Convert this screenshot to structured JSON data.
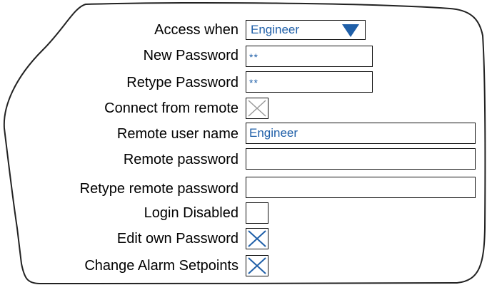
{
  "form": {
    "access_when": {
      "label": "Access when",
      "value": "Engineer"
    },
    "new_password": {
      "label": "New Password",
      "value": "**"
    },
    "retype_password": {
      "label": "Retype Password",
      "value": "**"
    },
    "connect_from_remote": {
      "label": "Connect from remote",
      "checked": true,
      "enabled": false
    },
    "remote_user_name": {
      "label": "Remote user name",
      "value": "Engineer"
    },
    "remote_password": {
      "label": "Remote password",
      "value": ""
    },
    "retype_remote_password": {
      "label": "Retype remote password",
      "value": ""
    },
    "login_disabled": {
      "label": "Login Disabled",
      "checked": false
    },
    "edit_own_password": {
      "label": "Edit own Password",
      "checked": true
    },
    "change_alarm_setpoints": {
      "label": "Change Alarm Setpoints",
      "checked": true
    }
  },
  "colors": {
    "value_text": "#1f5fa8",
    "check_active": "#1f5fa8",
    "check_disabled": "#9a9a9a",
    "dropdown_arrow": "#1f5fa8"
  },
  "icons": {
    "dropdown": "triangle-down-icon",
    "check": "x-mark-icon"
  }
}
